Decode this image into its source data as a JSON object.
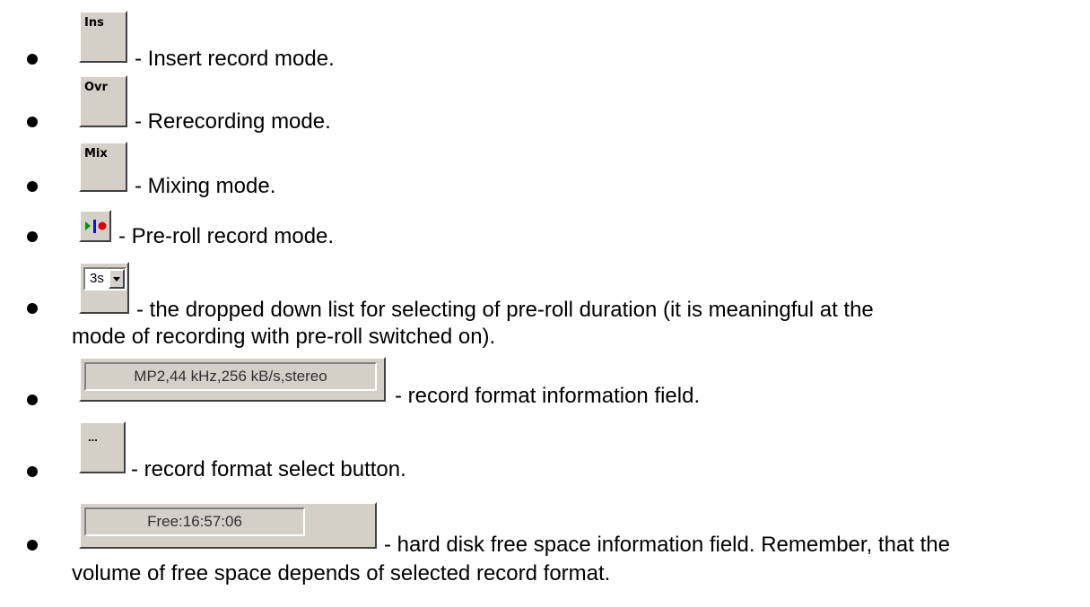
{
  "items": [
    {
      "control": "Ins",
      "text": "- Insert record mode."
    },
    {
      "control": "Ovr",
      "text": "- Rerecording mode."
    },
    {
      "control": "Mix",
      "text": "- Mixing mode."
    },
    {
      "control": "pre-roll-icon",
      "text": "- Pre-roll record mode."
    },
    {
      "control": "3s",
      "text": "- the dropped down list for selecting of pre-roll duration (it is meaningful at the",
      "text2": "mode of recording with pre-roll switched on)."
    },
    {
      "control": "MP2,44 kHz,256 kB/s,stereo",
      "text": "- record format information field."
    },
    {
      "control": "...",
      "text": "- record format select button."
    },
    {
      "control": "Free:16:57:06",
      "text": "- hard disk free space information field. Remember, that the",
      "text2": "volume of free space depends of selected record format."
    }
  ],
  "colors": {
    "button_face": "#d4d0c8",
    "preroll_green": "#009900",
    "preroll_blue": "#1010c0",
    "preroll_red": "#e00000"
  }
}
